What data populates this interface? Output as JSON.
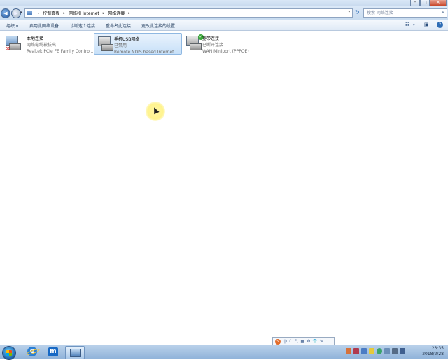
{
  "window": {
    "buttons": {
      "minimize": "─",
      "maximize": "□",
      "close": "✕"
    }
  },
  "navigation": {
    "back": "◀",
    "forward": "▶",
    "recent": "▾"
  },
  "address": {
    "breadcrumbs": [
      "控制面板",
      "网络和 Internet",
      "网络连接"
    ],
    "separator": "▸",
    "dropdown": "▾"
  },
  "refresh": "↻",
  "search": {
    "placeholder": "搜索 网络连接"
  },
  "commands": {
    "organize": "组织",
    "organize_arrow": "▼",
    "enable": "启用此网络设备",
    "diagnose": "诊断这个连接",
    "rename": "重命名此连接",
    "change_settings": "更改此连接的设置"
  },
  "connections": [
    {
      "name": "本地连接",
      "status": "网络电缆被拔出",
      "device": "Realtek PCIe FE Family Control...",
      "state": "unplugged",
      "selected": false
    },
    {
      "name": "手机USB网络",
      "status": "已禁用",
      "device": "Remote NDIS based Internet ...",
      "state": "disabled",
      "selected": true
    },
    {
      "name": "宽带连接",
      "status": "已断开连接",
      "device": "WAN Miniport (PPPOE)",
      "state": "disconnected",
      "selected": false
    }
  ],
  "langbar": {
    "mode": "中"
  },
  "clock": {
    "time": "23:35",
    "date": "2018/2/28"
  },
  "colors": {
    "selection": "#c7e0f8",
    "taskbar": "#8fb2d9",
    "error_badge": "#d21a1a",
    "ok_badge": "#3aa83a"
  }
}
